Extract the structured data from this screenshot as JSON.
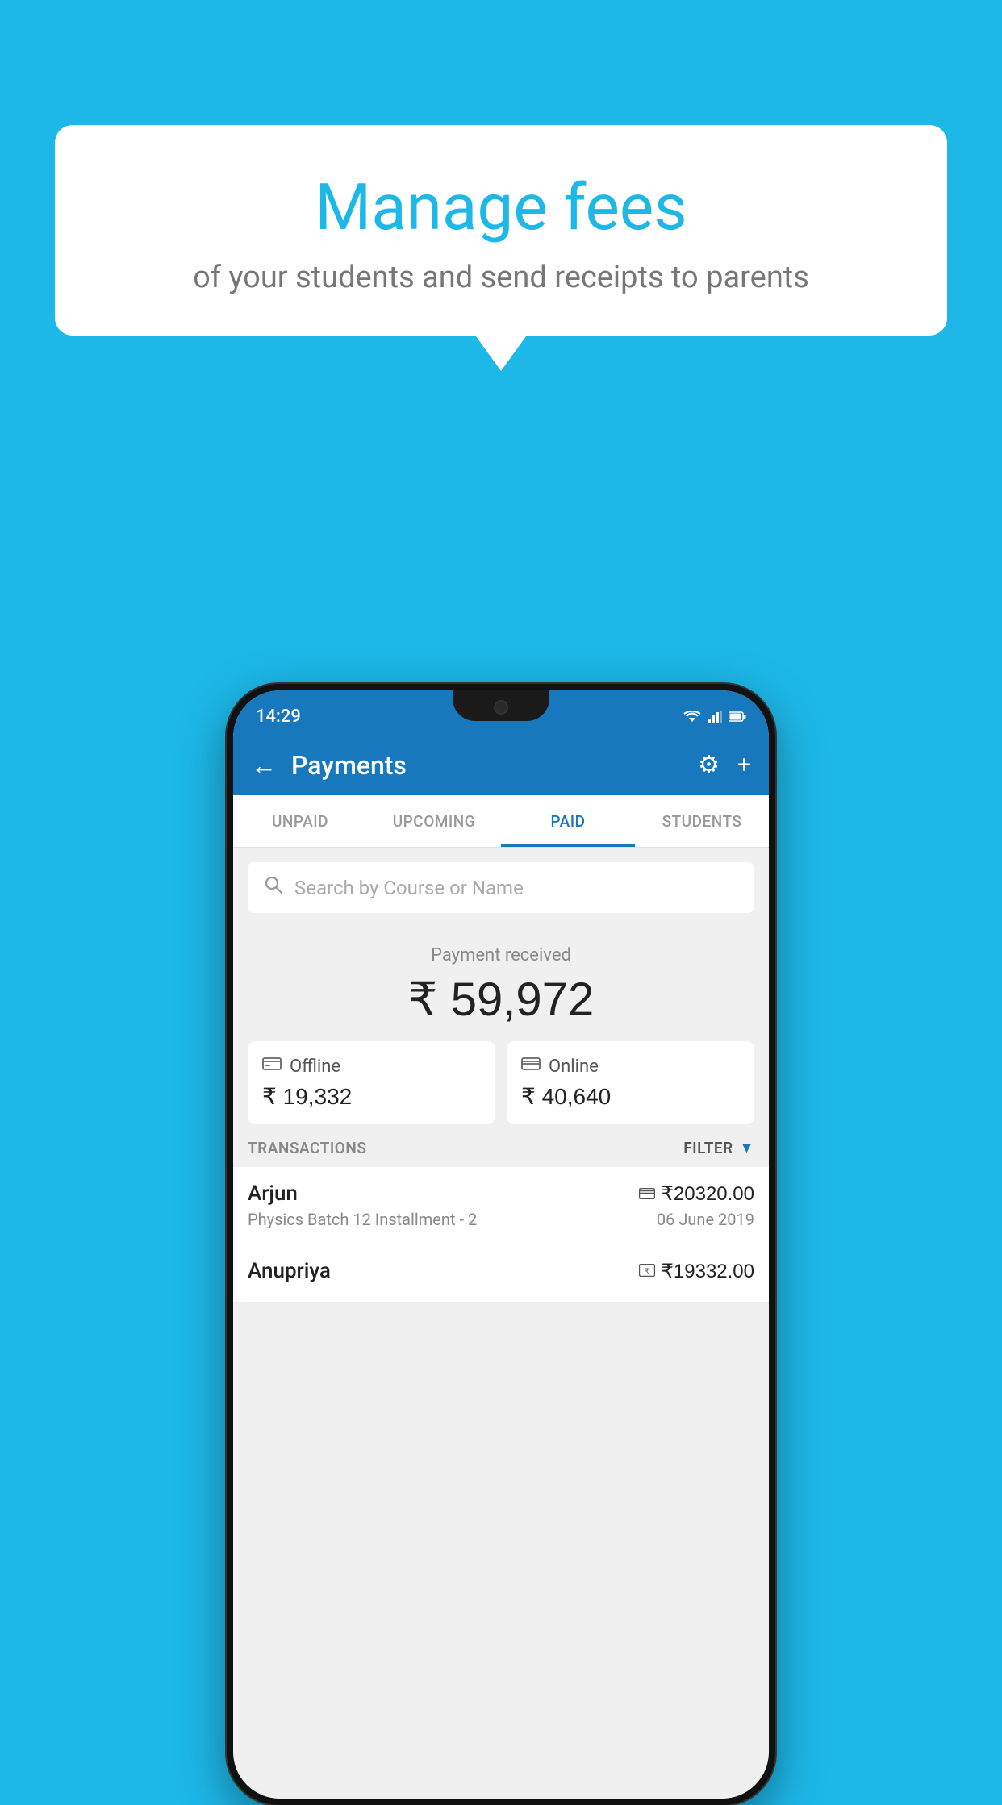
{
  "background_color": "#1db8e8",
  "bubble": {
    "title": "Manage fees",
    "subtitle": "of your students and send receipts to parents"
  },
  "status_bar": {
    "time": "14:29",
    "wifi_icon": "▲",
    "signal_icon": "▲",
    "battery_icon": "▮"
  },
  "header": {
    "title": "Payments",
    "back_label": "←",
    "gear_label": "⚙",
    "plus_label": "+"
  },
  "tabs": [
    {
      "label": "UNPAID",
      "active": false
    },
    {
      "label": "UPCOMING",
      "active": false
    },
    {
      "label": "PAID",
      "active": true
    },
    {
      "label": "STUDENTS",
      "active": false
    }
  ],
  "search": {
    "placeholder": "Search by Course or Name"
  },
  "payment_summary": {
    "label": "Payment received",
    "amount": "₹ 59,972"
  },
  "payment_cards": [
    {
      "icon": "🪙",
      "label": "Offline",
      "amount": "₹ 19,332"
    },
    {
      "icon": "💳",
      "label": "Online",
      "amount": "₹ 40,640"
    }
  ],
  "transactions_label": "TRANSACTIONS",
  "filter_label": "FILTER",
  "transactions": [
    {
      "name": "Arjun",
      "payment_method": "card",
      "amount": "₹20320.00",
      "course": "Physics Batch 12 Installment - 2",
      "date": "06 June 2019"
    },
    {
      "name": "Anupriya",
      "payment_method": "cash",
      "amount": "₹19332.00",
      "course": "",
      "date": ""
    }
  ]
}
